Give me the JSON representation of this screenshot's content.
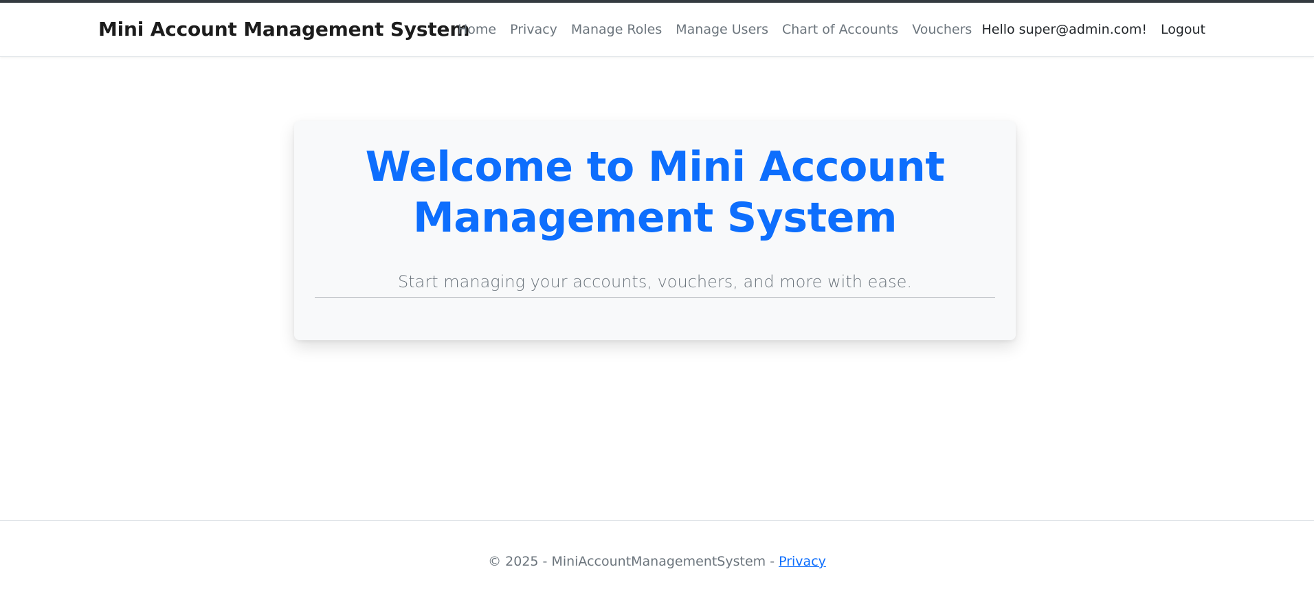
{
  "nav": {
    "brand": "Mini Account Management System",
    "links": [
      "Home",
      "Privacy",
      "Manage Roles",
      "Manage Users",
      "Chart of Accounts",
      "Vouchers"
    ],
    "greeting": "Hello super@admin.com!",
    "logout": "Logout"
  },
  "main": {
    "title": "Welcome to Mini Account Management System",
    "subtitle": "Start managing your accounts, vouchers, and more with ease."
  },
  "footer": {
    "text": "© 2025 - MiniAccountManagementSystem - ",
    "privacy_link": "Privacy"
  },
  "colors": {
    "accent": "#0d6efd",
    "muted": "#6c757d",
    "card_bg": "#f8f9fa"
  }
}
